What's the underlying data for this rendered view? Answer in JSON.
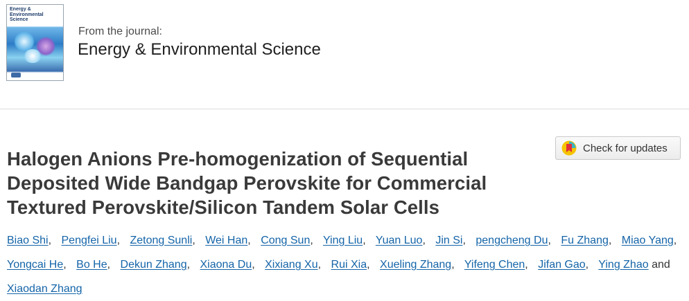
{
  "journal": {
    "cover_title": "Energy & Environmental Science",
    "from_label": "From the journal:",
    "title": "Energy & Environmental Science"
  },
  "article": {
    "title_lines": [
      "Halogen Anions Pre-homogenization of Sequential",
      "Deposited Wide Bandgap Perovskite for Commercial",
      "Textured Perovskite/Silicon Tandem Solar Cells"
    ],
    "check_updates_label": "Check for updates"
  },
  "authors": [
    "Biao Shi",
    "Pengfei Liu",
    "Zetong Sunli",
    "Wei Han",
    "Cong Sun",
    "Ying Liu",
    "Yuan Luo",
    "Jin Si",
    "pengcheng Du",
    "Fu Zhang",
    "Miao Yang",
    "Yongcai He",
    "Bo He",
    "Dekun Zhang",
    "Xiaona Du",
    "Xixiang Xu",
    "Rui Xia",
    "Xueling Zhang",
    "Yifeng Chen",
    "Jifan Gao",
    "Ying Zhao",
    "Xiaodan Zhang"
  ],
  "authors_separator": ",",
  "authors_and": "and"
}
